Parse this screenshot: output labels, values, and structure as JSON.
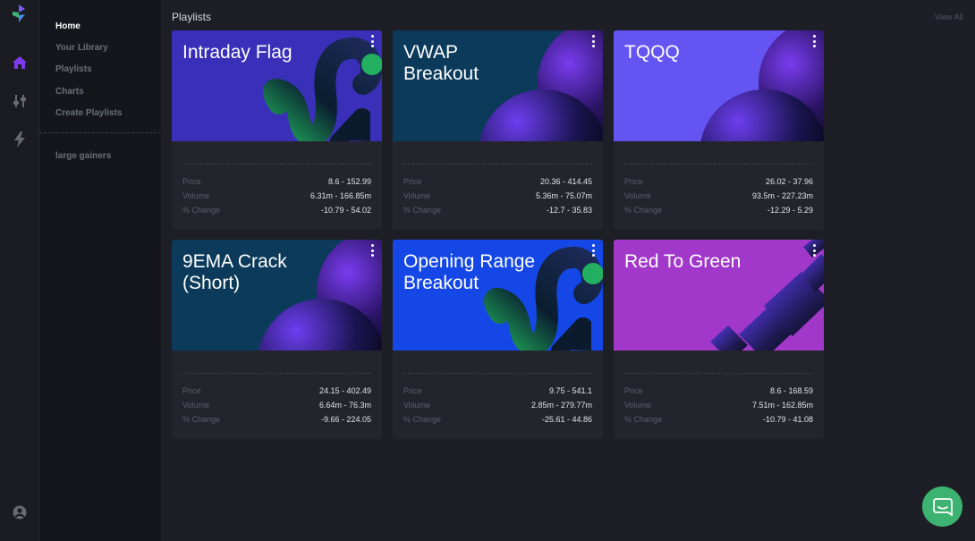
{
  "nav": {
    "items": [
      {
        "label": "Home",
        "active": true
      },
      {
        "label": "Your Library"
      },
      {
        "label": "Playlists"
      },
      {
        "label": "Charts"
      },
      {
        "label": "Create Playlists"
      }
    ],
    "saved": [
      {
        "label": "large gainers"
      }
    ]
  },
  "rail": {
    "icons": [
      "logo-icon",
      "home-icon",
      "settings-sliders-icon",
      "lightning-icon",
      "user-icon"
    ],
    "accent": "#7c3aed"
  },
  "main": {
    "title": "Playlists",
    "view_all": "View All",
    "stat_labels": {
      "price": "Price",
      "volume": "Volume",
      "change": "% Change"
    },
    "cards": [
      {
        "title": "Intraday Flag",
        "art": "swoosh",
        "bg": "#3a2fb8",
        "price": "8.6 - 152.99",
        "volume": "6.31m - 166.85m",
        "change": "-10.79 - 54.02"
      },
      {
        "title": "VWAP Breakout",
        "art": "orb",
        "bg": "#0b3a5a",
        "price": "20.36 - 414.45",
        "volume": "5.36m - 75.07m",
        "change": "-12.7 - 35.83"
      },
      {
        "title": "TQQQ",
        "art": "orb",
        "bg": "#6455f2",
        "price": "26.02 - 37.96",
        "volume": "93.5m - 227.23m",
        "change": "-12.29 - 5.29"
      },
      {
        "title": "9EMA Crack (Short)",
        "art": "orb",
        "bg": "#0b3a5a",
        "price": "24.15 - 402.49",
        "volume": "6.64m - 76.3m",
        "change": "-9.66 - 224.05"
      },
      {
        "title": "Opening Range Breakout",
        "art": "swoosh",
        "bg": "#1447e6",
        "price": "9.75 - 541.1",
        "volume": "2.85m - 279.77m",
        "change": "-25.61 - 44.86"
      },
      {
        "title": "Red To Green",
        "art": "bars",
        "bg": "#a138c9",
        "price": "8.6 - 168.59",
        "volume": "7.51m - 162.85m",
        "change": "-10.79 - 41.08"
      }
    ]
  },
  "chat": {
    "icon": "chat-icon",
    "color": "#3cb371"
  }
}
